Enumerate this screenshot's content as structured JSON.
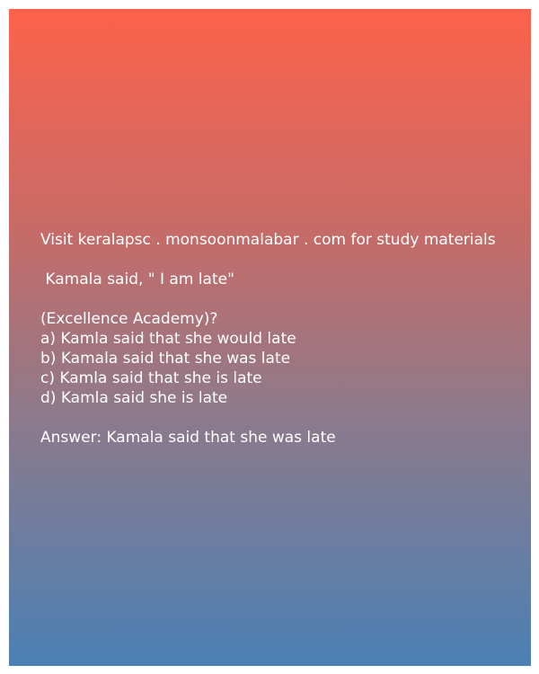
{
  "site_note": "Visit keralapsc . monsoonmalabar . com for study materials",
  "question": " Kamala said, \" I am late\"",
  "source": "(Excellence Academy)?",
  "options": [
    "a) Kamla said that she would late",
    "b) Kamala said that she was late",
    "c) Kamla said that she is late",
    "d) Kamla said she is late"
  ],
  "answer": "Answer: Kamala said that she was late",
  "colors": {
    "gradient_top": "#fd624b",
    "gradient_bottom": "#4b80b5",
    "text": "#ffffff"
  }
}
